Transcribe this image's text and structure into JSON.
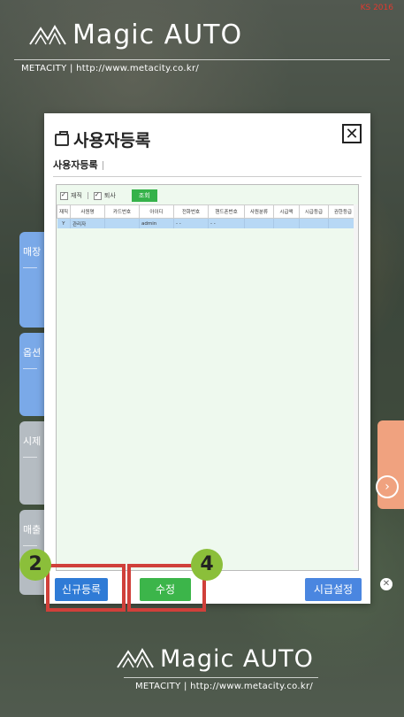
{
  "corner_note": "KS 2016",
  "brand": {
    "name": "Magic AUTO",
    "subtitle": "METACITY  |  http://www.metacity.co.kr/"
  },
  "side_tabs": [
    {
      "label": "매장",
      "color": "#7aa9e8"
    },
    {
      "label": "옵션",
      "color": "#7aa9e8"
    },
    {
      "label": "시제",
      "color": "#b5bcc2"
    },
    {
      "label": "매출",
      "color": "#b5bcc2"
    }
  ],
  "modal": {
    "title": "사용자등록",
    "breadcrumb": "사용자등록",
    "close_symbol": "✕",
    "filters": {
      "employed_label": "재직",
      "resigned_label": "퇴사",
      "search_button": "조회"
    },
    "table": {
      "columns": [
        "재직",
        "사원명",
        "카드번호",
        "아이디",
        "전화번호",
        "핸드폰번호",
        "사원분류",
        "시급액",
        "시급등급",
        "권한등급"
      ],
      "rows": [
        [
          "Y",
          "관리자",
          "",
          "admin",
          "- -",
          "- -",
          "",
          "",
          "",
          ""
        ]
      ]
    },
    "buttons": {
      "new": "신규등록",
      "edit": "수정",
      "wage": "시급설정"
    }
  },
  "annotations": [
    {
      "label": "2",
      "color": "#8bbf3a"
    },
    {
      "label": "4",
      "color": "#8bbf3a"
    }
  ],
  "highlight_color": "#d0403a",
  "right_tab_symbol": "›"
}
